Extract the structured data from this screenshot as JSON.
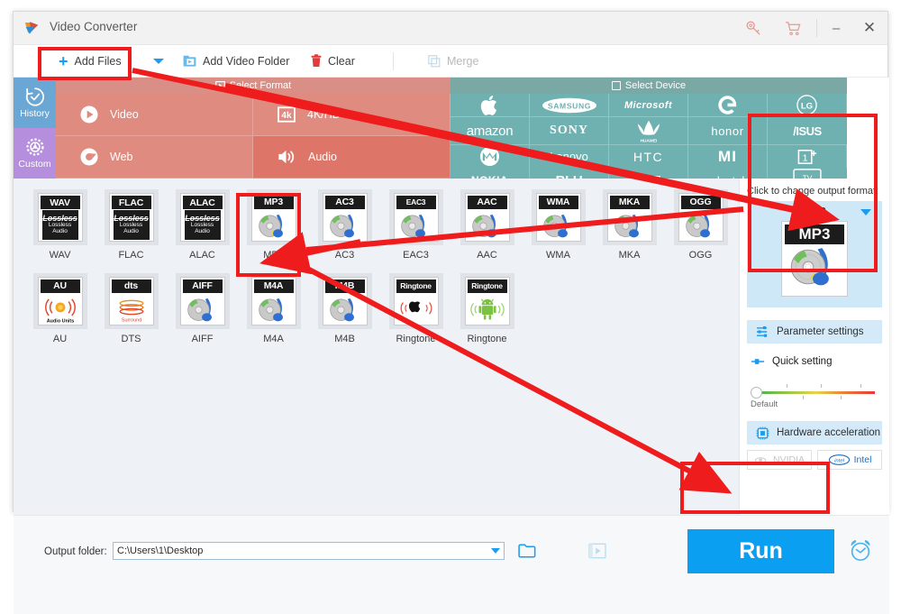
{
  "window": {
    "title": "Video Converter",
    "buttons": {
      "key": "key-icon",
      "cart": "cart-icon",
      "minimize": "–",
      "close": "✕"
    }
  },
  "toolbar": {
    "add_files": "Add Files",
    "add_files_caret": "chevron-down-icon",
    "add_video_folder": "Add Video Folder",
    "clear": "Clear",
    "merge": "Merge"
  },
  "sidebar": {
    "items": [
      {
        "label": "History",
        "icon": "history-icon",
        "color": "#6aa7d4"
      },
      {
        "label": "Custom",
        "icon": "gear-icon",
        "color": "#b58fdd"
      }
    ]
  },
  "format_header": "Select Format",
  "device_header": "Select Device",
  "format_tabs": [
    {
      "label": "Video",
      "icon": "play-icon",
      "selected": false
    },
    {
      "label": "4K/HD",
      "icon": "4k-icon",
      "selected": false
    },
    {
      "label": "Web",
      "icon": "chrome-icon",
      "selected": false
    },
    {
      "label": "Audio",
      "icon": "speaker-icon",
      "selected": true
    }
  ],
  "device_tabs": [
    {
      "label": "Apple",
      "icon": "apple-logo"
    },
    {
      "label": "SAMSUNG",
      "icon": "samsung-logo"
    },
    {
      "label": "Microsoft",
      "icon": "microsoft-logo"
    },
    {
      "label": "G",
      "icon": "google-logo"
    },
    {
      "label": "LG",
      "icon": "lg-logo"
    },
    {
      "label": "amazon",
      "icon": "amazon-logo"
    },
    {
      "label": "SONY",
      "icon": "sony-logo"
    },
    {
      "label": "HUAWEI",
      "icon": "huawei-logo"
    },
    {
      "label": "honor",
      "icon": "honor-logo"
    },
    {
      "label": "/ISUS",
      "icon": "asus-logo"
    },
    {
      "label": "Motorola",
      "icon": "motorola-logo"
    },
    {
      "label": "Lenovo",
      "icon": "lenovo-logo"
    },
    {
      "label": "HTC",
      "icon": "htc-logo"
    },
    {
      "label": "MI",
      "icon": "xiaomi-logo"
    },
    {
      "label": "1+",
      "icon": "oneplus-logo"
    },
    {
      "label": "NOKIA",
      "icon": "nokia-logo"
    },
    {
      "label": "BLU",
      "icon": "blu-logo"
    },
    {
      "label": "ZTE",
      "icon": "zte-logo"
    },
    {
      "label": "alcatel",
      "icon": "alcatel-logo"
    },
    {
      "label": "TV",
      "icon": "tv-icon"
    }
  ],
  "formats": {
    "row1": [
      {
        "name": "WAV",
        "badge": "WAV",
        "thumb": "lossless",
        "selected": false
      },
      {
        "name": "FLAC",
        "badge": "FLAC",
        "thumb": "lossless",
        "selected": false
      },
      {
        "name": "ALAC",
        "badge": "ALAC",
        "thumb": "lossless",
        "selected": false
      },
      {
        "name": "MP3",
        "badge": "MP3",
        "thumb": "disc",
        "selected": true
      },
      {
        "name": "AC3",
        "badge": "AC3",
        "thumb": "disc",
        "selected": false
      },
      {
        "name": "EAC3",
        "badge": "EAC3",
        "thumb": "disc",
        "selected": false
      },
      {
        "name": "AAC",
        "badge": "AAC",
        "thumb": "disc",
        "selected": false
      },
      {
        "name": "WMA",
        "badge": "WMA",
        "thumb": "disc",
        "selected": false
      },
      {
        "name": "MKA",
        "badge": "MKA",
        "thumb": "disc",
        "selected": false
      },
      {
        "name": "OGG",
        "badge": "OGG",
        "thumb": "disc",
        "selected": false
      }
    ],
    "row2": [
      {
        "name": "AU",
        "badge": "AU",
        "thumb": "au",
        "sub": "Audio Units",
        "selected": false
      },
      {
        "name": "DTS",
        "badge": "dts",
        "thumb": "dts",
        "sub": "Surround",
        "selected": false
      },
      {
        "name": "AIFF",
        "badge": "AIFF",
        "thumb": "disc",
        "selected": false
      },
      {
        "name": "M4A",
        "badge": "M4A",
        "thumb": "disc",
        "selected": false
      },
      {
        "name": "M4B",
        "badge": "M4B",
        "thumb": "disc",
        "selected": false
      },
      {
        "name": "Ringtone",
        "badge": "Ringtone",
        "thumb": "ring-apple",
        "selected": false
      },
      {
        "name": "Ringtone",
        "badge": "Ringtone",
        "thumb": "ring-android",
        "selected": false
      }
    ],
    "lossless_badge_line1": "Lossless",
    "lossless_badge_line2": "Lossless Audio"
  },
  "right_panel": {
    "hint": "Click to change output format:",
    "output_format": "MP3",
    "parameter_settings": "Parameter settings",
    "quick_setting": "Quick setting",
    "slider_label": "Default",
    "hardware_acceleration": "Hardware acceleration",
    "nvidia": "NVIDIA",
    "intel": "Intel"
  },
  "bottom": {
    "output_folder_label": "Output folder:",
    "output_folder_value": "C:\\Users\\1\\Desktop",
    "run_label": "Run",
    "alarm_icon": "alarm-clock-icon",
    "folder_icon": "folder-open-icon",
    "preview_icon": "film-preview-icon"
  },
  "annotations": {
    "highlight_color": "#ee1c1c",
    "boxes": [
      "add-files-button",
      "mp3-format-tile",
      "output-format-preview",
      "run-button"
    ]
  },
  "colors": {
    "accent_blue": "#0a9ff0",
    "format_band": "#e08b80",
    "device_band": "#6fb1b1",
    "history": "#6aa7d4",
    "custom": "#b58fdd"
  }
}
